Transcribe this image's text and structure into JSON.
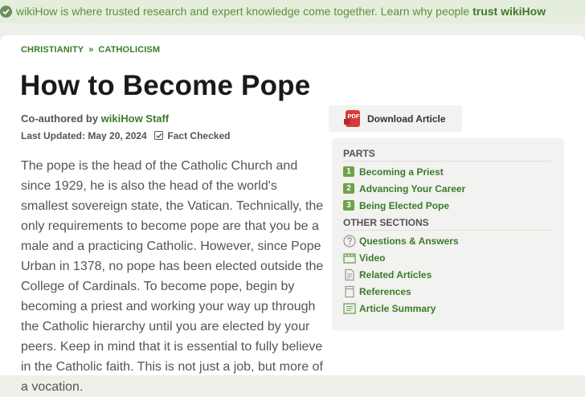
{
  "banner": {
    "text": "wikiHow is where trusted research and expert knowledge come together. Learn why people ",
    "link": "trust wikiHow"
  },
  "breadcrumb": [
    "CHRISTIANITY",
    "CATHOLICISM"
  ],
  "breadcrumb_sep": "»",
  "title": "How to Become Pope",
  "byline": {
    "prefix": "Co-authored by ",
    "author": "wikiHow Staff"
  },
  "updated": {
    "text": "Last Updated: May 20, 2024",
    "fact_checked": "Fact Checked"
  },
  "intro": "The pope is the head of the Catholic Church and since 1929, he is also the head of the world's smallest sovereign state, the Vatican. Technically, the only requirements to become pope are that you be a male and a practicing Catholic. However, since Pope Urban in 1378, no pope has been elected outside the College of Cardinals. To become pope, begin by becoming a priest and working your way up through the Catholic hierarchy until you are elected by your peers. Keep in mind that it is essential to fully believe in the Catholic faith. This is not just a job, but more of a vocation.",
  "download": {
    "label": "Download Article",
    "icon": "pdf-icon",
    "icon_text": "PDF"
  },
  "toc": {
    "parts_heading": "PARTS",
    "parts": [
      {
        "num": "1",
        "label": "Becoming a Priest"
      },
      {
        "num": "2",
        "label": "Advancing Your Career"
      },
      {
        "num": "3",
        "label": "Being Elected Pope"
      }
    ],
    "other_heading": "OTHER SECTIONS",
    "other": [
      {
        "label": "Questions & Answers",
        "icon": "question-icon"
      },
      {
        "label": "Video",
        "icon": "video-icon"
      },
      {
        "label": "Related Articles",
        "icon": "document-icon"
      },
      {
        "label": "References",
        "icon": "references-icon"
      },
      {
        "label": "Article Summary",
        "icon": "summary-icon"
      }
    ]
  },
  "colors": {
    "brand_green": "#3b7b28",
    "banner_bg": "#e5eedd",
    "number_badge": "#6ea24b",
    "pdf_red": "#d63c3c"
  }
}
